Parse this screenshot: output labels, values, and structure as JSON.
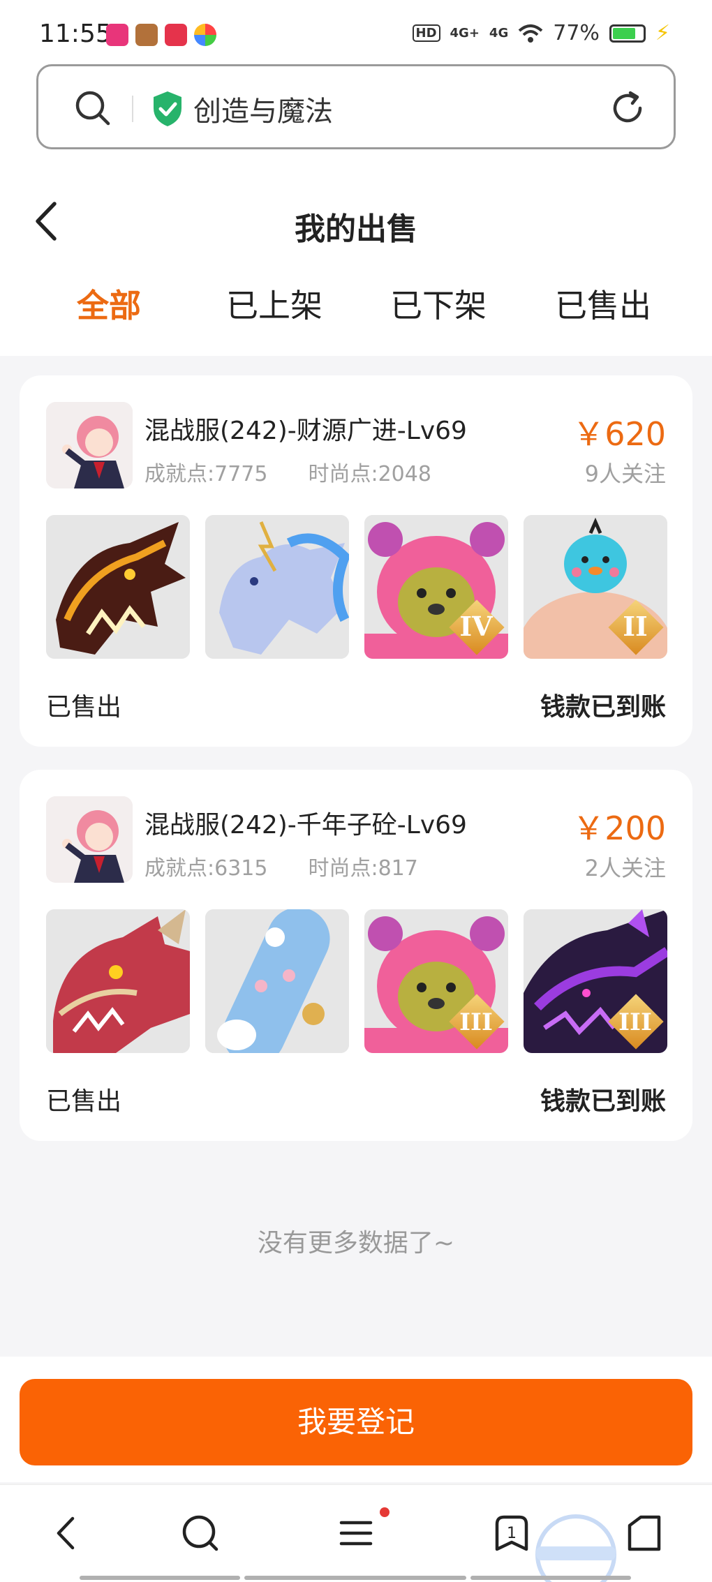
{
  "status_bar": {
    "time": "11:55",
    "network_1": "4G+",
    "network_2": "4G",
    "battery": "77%",
    "battery_level": 0.77
  },
  "browser": {
    "search_text": "创造与魔法"
  },
  "header": {
    "title": "我的出售"
  },
  "tabs": [
    {
      "label": "全部",
      "active": true
    },
    {
      "label": "已上架",
      "active": false
    },
    {
      "label": "已下架",
      "active": false
    },
    {
      "label": "已售出",
      "active": false
    }
  ],
  "listings": [
    {
      "title": "混战服(242)-财源广进-Lv69",
      "achievement": "成就点:7775",
      "fashion": "时尚点:2048",
      "price": "￥620",
      "followers": "9人关注",
      "status": "已售出",
      "payment": "钱款已到账",
      "badges": [
        "",
        "",
        "IV",
        "II"
      ]
    },
    {
      "title": "混战服(242)-千年子砼-Lv69",
      "achievement": "成就点:6315",
      "fashion": "时尚点:817",
      "price": "￥200",
      "followers": "2人关注",
      "status": "已售出",
      "payment": "钱款已到账",
      "badges": [
        "",
        "",
        "III",
        "III"
      ]
    }
  ],
  "footer_text": "没有更多数据了~",
  "register_button": "我要登记",
  "nav": {
    "tabs_count": "1"
  },
  "colors": {
    "accent": "#ec6a12",
    "button": "#fa6305"
  }
}
